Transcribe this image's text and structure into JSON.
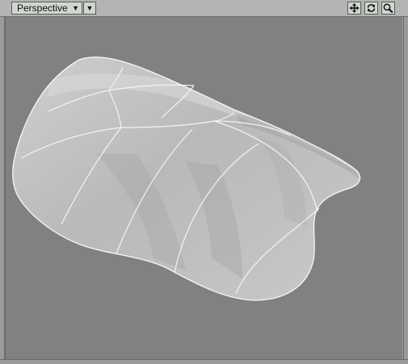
{
  "viewport": {
    "view_mode": "Perspective",
    "view_mode_dropdown_icon": "triangle-down",
    "view_menu_icon": "triangle-down",
    "tools": [
      {
        "name": "move-view-icon",
        "symbol": "four-way-arrows"
      },
      {
        "name": "rotate-view-icon",
        "symbol": "rotate-arrows"
      },
      {
        "name": "zoom-view-icon",
        "symbol": "magnifier"
      }
    ]
  },
  "colors": {
    "background": "#818181",
    "toolbar": "#b4b4b4",
    "button": "#cfd8cf",
    "surface_light": "#d4d4d4",
    "surface_dark": "#a9a9a9",
    "wireframe": "#f5f5f5"
  }
}
